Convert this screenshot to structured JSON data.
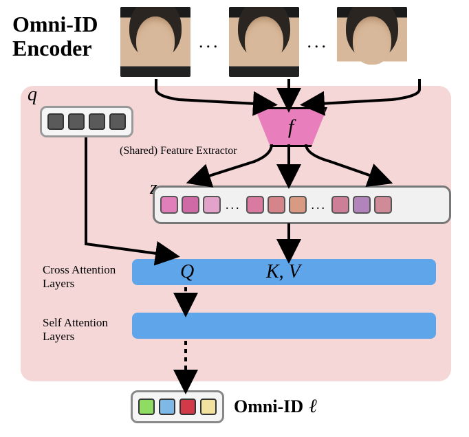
{
  "title_line1": "Omni-ID",
  "title_line2": "Encoder",
  "ellipsis": "...",
  "q_symbol": "q",
  "f_symbol": "f",
  "z_symbol": "z",
  "feature_extractor_label": "(Shared) Feature Extractor",
  "cross_attn_label_line1": "Cross Attention",
  "cross_attn_label_line2": "Layers",
  "self_attn_label_line1": "Self Attention",
  "self_attn_label_line2": "Layers",
  "cross_Q": "Q",
  "cross_KV": "K, V",
  "output_label": "Omni-ID",
  "output_symbol": "ℓ",
  "q_tokens": [
    "#5a5a5a",
    "#5a5a5a",
    "#5a5a5a",
    "#5a5a5a"
  ],
  "z_tokens_group1": [
    "#e07fba",
    "#cf6aa7",
    "#e3a2ca"
  ],
  "z_tokens_group2": [
    "#d97aa0",
    "#d5858a",
    "#d99a84"
  ],
  "z_tokens_group3": [
    "#ce7f98",
    "#b185bb",
    "#cf8b97"
  ],
  "output_tokens": [
    "#8edc62",
    "#7eb8e6",
    "#d23a4a",
    "#f2e2a0"
  ]
}
